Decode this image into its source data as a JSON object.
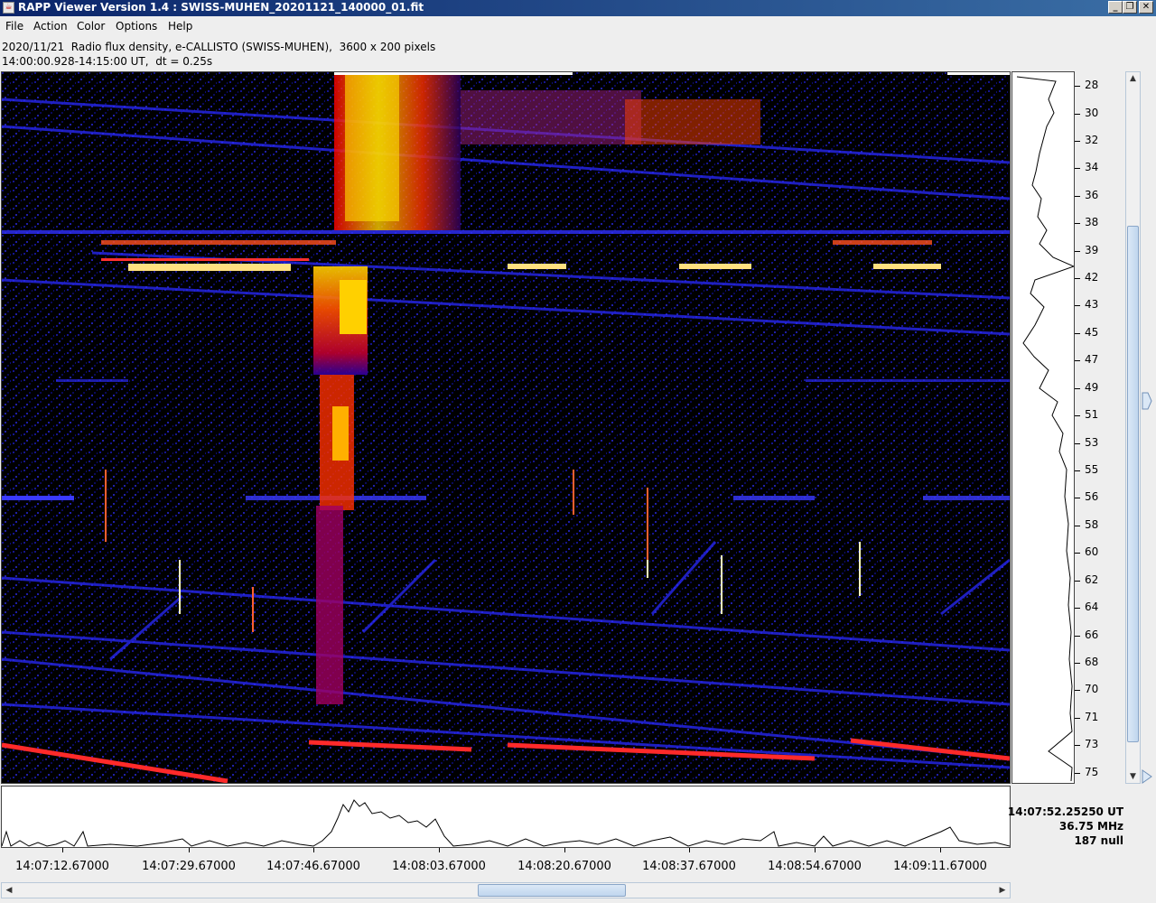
{
  "window": {
    "title": "RAPP Viewer Version 1.4 : SWISS-MUHEN_20201121_140000_01.fit"
  },
  "menu": [
    "File",
    "Action",
    "Color",
    "Options",
    "Help"
  ],
  "info": {
    "line1": "2020/11/21  Radio flux density, e-CALLISTO (SWISS-MUHEN),  3600 x 200 pixels",
    "line2": "14:00:00.928-14:15:00 UT,  dt = 0.25s"
  },
  "freq_labels": [
    "28",
    "30",
    "32",
    "34",
    "36",
    "38",
    "39",
    "42",
    "43",
    "45",
    "47",
    "49",
    "51",
    "53",
    "55",
    "56",
    "58",
    "60",
    "62",
    "64",
    "66",
    "68",
    "70",
    "71",
    "73",
    "75"
  ],
  "time_labels": [
    "14:07:12.67000",
    "14:07:29.67000",
    "14:07:46.67000",
    "14:08:03.67000",
    "14:08:20.67000",
    "14:08:37.67000",
    "14:08:54.67000",
    "14:09:11.67000"
  ],
  "readout": {
    "time": "14:07:52.25250 UT",
    "freq": "36.75 MHz",
    "value": "187 null"
  },
  "colors": {
    "titlebar_start": "#0a246a",
    "titlebar_end": "#3a6ea5",
    "background": "#000000",
    "burst": "#ffe000",
    "rfi": "#2020ff"
  },
  "icons": {
    "app": "java-cup-icon",
    "minimize": "minimize-icon",
    "maximize": "maximize-icon",
    "close": "close-icon"
  }
}
